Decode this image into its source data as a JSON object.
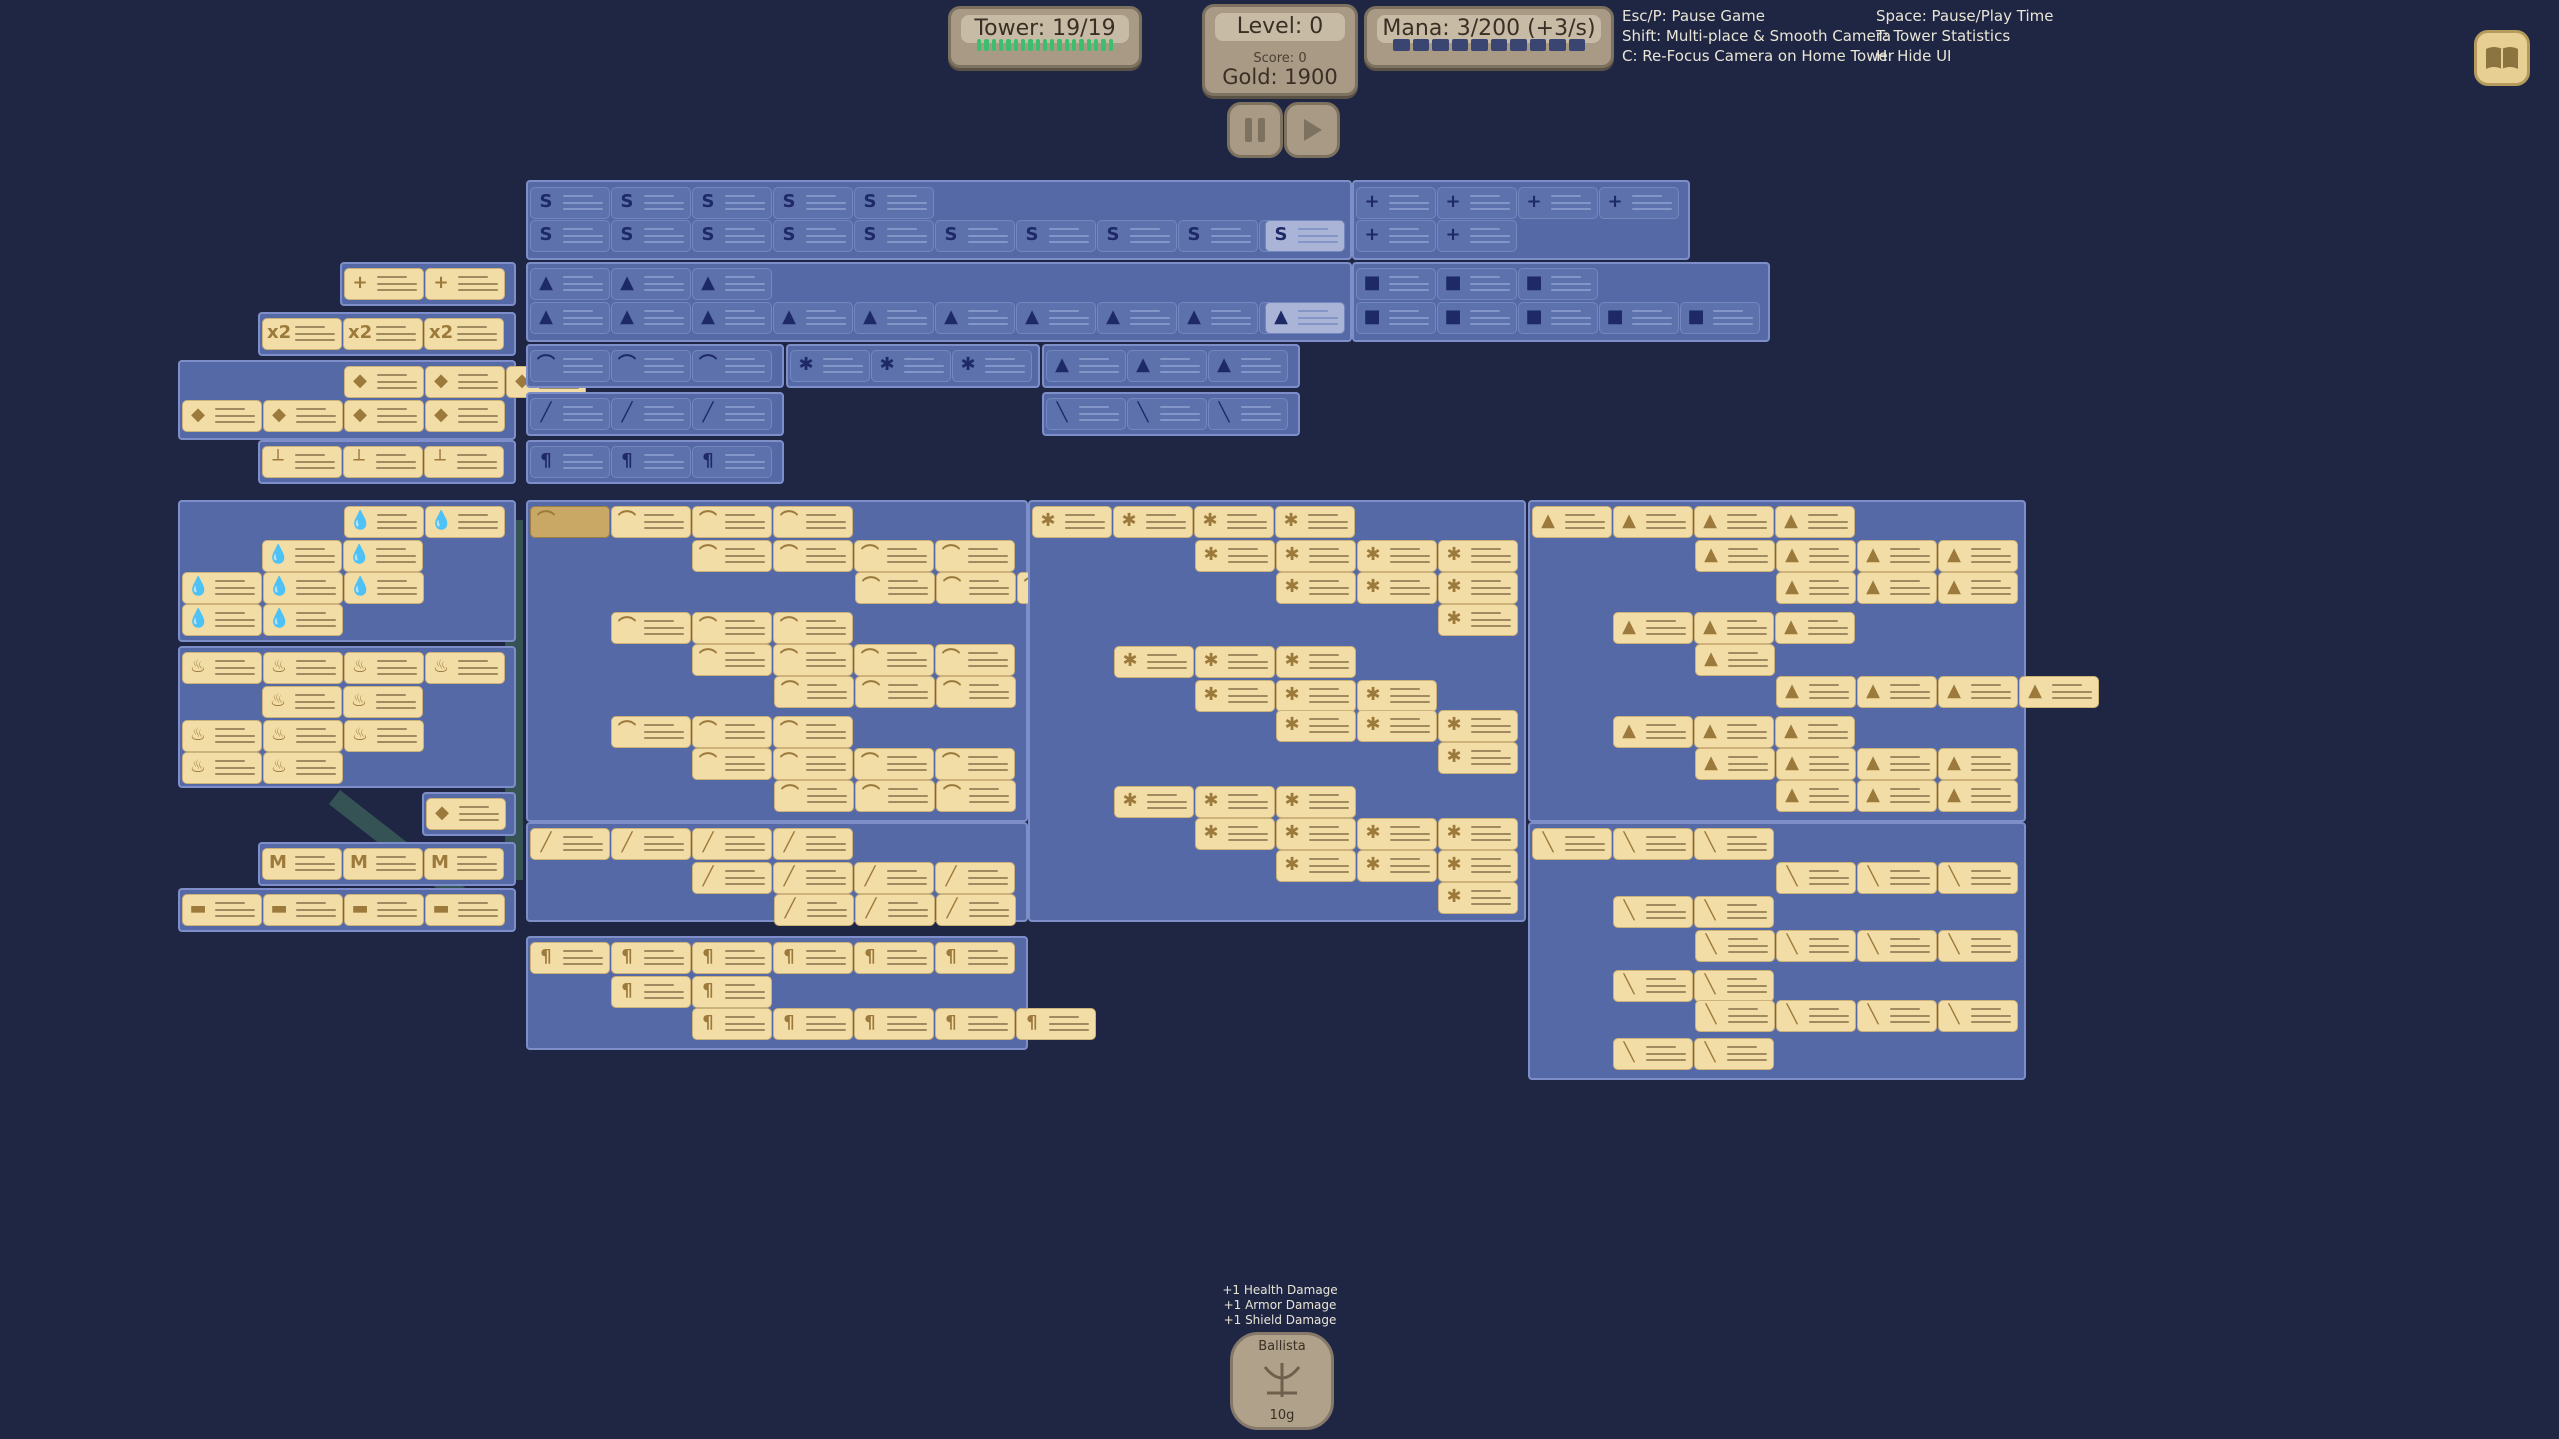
{
  "hud": {
    "tower_label": "Tower: 19/19",
    "level_label": "Level: 0",
    "score_label": "Score: 0",
    "gold_label": "Gold: 1900",
    "mana_label": "Mana: 3/200 (+3/s)",
    "tower_bar_color": "#3bbf6e",
    "mana_bar_color": "#3b4572"
  },
  "hints": {
    "left": "Esc/P: Pause Game\nShift: Multi-place & Smooth Camera\nC: Re-Focus Camera on Home Tower",
    "right": "Space: Pause/Play Time\nT: Tower Statistics\nH: Hide UI"
  },
  "controls": {
    "pause_icon": "pause-icon",
    "play_icon": "play-icon",
    "book_icon": "book-icon"
  },
  "selected_tower": {
    "stats": [
      "+1 Health Damage",
      "+1 Armor Damage",
      "+1 Shield Damage"
    ],
    "name": "Ballista",
    "cost": "10g",
    "icon": "ballista-icon"
  },
  "colors": {
    "background": "#1f2644",
    "panel": "#5469a6",
    "card_unlocked": "#f3dda6",
    "card_locked": "#5d71ad",
    "card_selected": "#c9a866"
  }
}
